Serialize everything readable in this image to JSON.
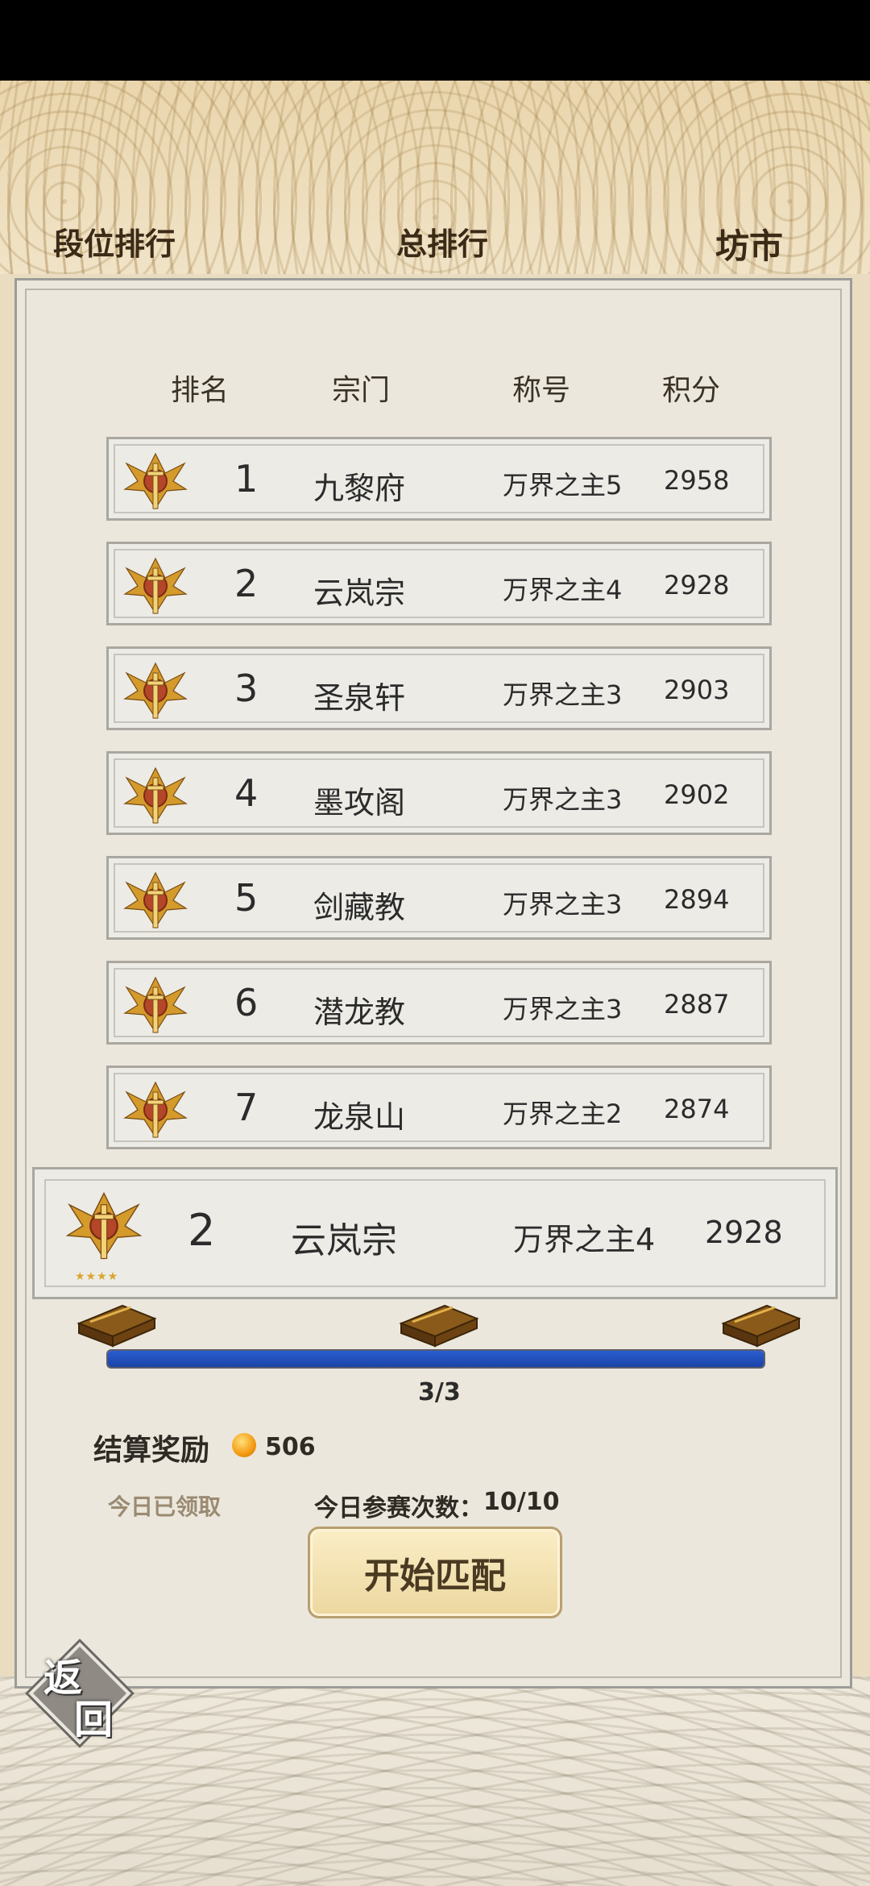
{
  "tabs": {
    "rank": "段位排行",
    "total": "总排行",
    "market": "坊市"
  },
  "columns": {
    "rank": "排名",
    "sect": "宗门",
    "title": "称号",
    "score": "积分"
  },
  "rows": [
    {
      "rank": "1",
      "sect": "九黎府",
      "title": "万界之主5",
      "score": "2958"
    },
    {
      "rank": "2",
      "sect": "云岚宗",
      "title": "万界之主4",
      "score": "2928"
    },
    {
      "rank": "3",
      "sect": "圣泉轩",
      "title": "万界之主3",
      "score": "2903"
    },
    {
      "rank": "4",
      "sect": "墨攻阁",
      "title": "万界之主3",
      "score": "2902"
    },
    {
      "rank": "5",
      "sect": "剑藏教",
      "title": "万界之主3",
      "score": "2894"
    },
    {
      "rank": "6",
      "sect": "潜龙教",
      "title": "万界之主3",
      "score": "2887"
    },
    {
      "rank": "7",
      "sect": "龙泉山",
      "title": "万界之主2",
      "score": "2874"
    }
  ],
  "me": {
    "rank": "2",
    "sect": "云岚宗",
    "title": "万界之主4",
    "score": "2928",
    "stars": "★★★★"
  },
  "progress": {
    "value": 1.0,
    "text": "3/3"
  },
  "reward": {
    "label": "结算奖励",
    "value": "506",
    "claimed": "今日已领取"
  },
  "attempts": {
    "label": "今日参赛次数：",
    "value": "10/10"
  },
  "start_button": "开始匹配",
  "back": {
    "char1": "返",
    "char2": "回"
  },
  "icons": {
    "emblem": "golden-winged-sword-emblem-icon",
    "chest": "treasure-chest-icon",
    "coin": "gold-coin-icon"
  },
  "colors": {
    "progress_fill": "#1f4fbf",
    "button": "#f3e2b0"
  }
}
